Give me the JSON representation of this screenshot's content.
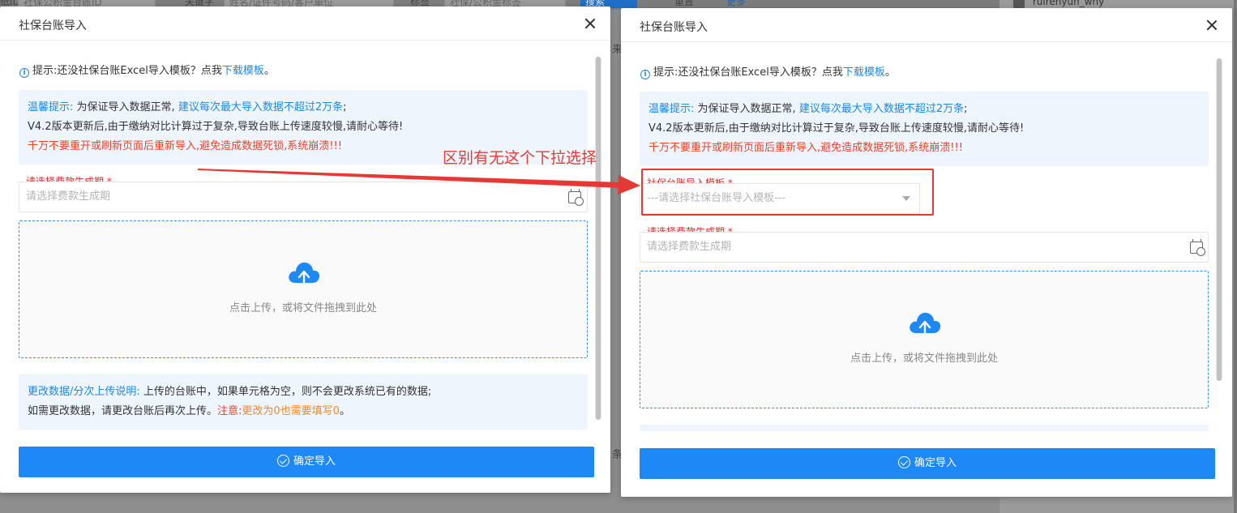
{
  "background": {
    "filter_fragments": [
      "纸ID",
      "社保公积金台账ID",
      "关键字",
      "姓名/证件号码/客户单位",
      "标签",
      "社保/公积金标签"
    ],
    "search_label": "搜索",
    "reset_label": "重置",
    "more_label": "更多",
    "username": "ruirenyun_why",
    "side_fragments": [
      "来",
      "条"
    ]
  },
  "dialogs": [
    {
      "title": "社保台账导入",
      "tip_prefix": "提示:还没社保台账Excel导入模板？点我",
      "tip_link": "下载模板",
      "tip_suffix": "。",
      "notice_title": "温馨提示:",
      "notice_line1_a": "为保证导入数据正常,",
      "notice_line1_b": "建议每次最大导入数据不超过2万条",
      "notice_line1_c": ";",
      "notice_line2": "V4.2版本更新后,由于缴纳对比计算过于复杂,导致台账上传速度较慢,请耐心等待!",
      "notice_line3": "千万不要重开或刷新页面后重新导入,避免造成数据死锁,系统崩溃!!!",
      "date_label": "请选择费款生成期",
      "date_placeholder": "请选择费款生成期",
      "upload_text": "点击上传，或将文件拖拽到此处",
      "desc_title": "更改数据/分次上传说明:",
      "desc_line1": "上传的台账中，如果单元格为空，则不会更改系统已有的数据;",
      "desc_line2_a": "如需更改数据，请更改台账后再次上传。",
      "desc_line2_b": "注意:",
      "desc_line2_c": "更改为0也需要填写0",
      "desc_line2_d": "。",
      "submit_label": "确定导入"
    },
    {
      "title": "社保台账导入",
      "tip_prefix": "提示:还没社保台账Excel导入模板？点我",
      "tip_link": "下载模板",
      "tip_suffix": "。",
      "notice_title": "温馨提示:",
      "notice_line1_a": "为保证导入数据正常,",
      "notice_line1_b": "建议每次最大导入数据不超过2万条",
      "notice_line1_c": ";",
      "notice_line2": "V4.2版本更新后,由于缴纳对比计算过于复杂,导致台账上传速度较慢,请耐心等待!",
      "notice_line3": "千万不要重开或刷新页面后重新导入,避免造成数据死锁,系统崩溃!!!",
      "template_label": "社保台账导入模板",
      "template_placeholder": "---请选择社保台账导入模板---",
      "date_label": "请选择费款生成期",
      "date_placeholder": "请选择费款生成期",
      "upload_text": "点击上传，或将文件拖拽到此处",
      "submit_label": "确定导入"
    }
  ],
  "annotation": {
    "text": "区别有无这个下拉选择"
  },
  "colors": {
    "accent_blue": "#1e88f5",
    "warning_red": "#e8442b",
    "annotation_red": "#e53935",
    "note_orange": "#f08a24",
    "notice_bg": "#eef5fc"
  },
  "icons": [
    "info-icon",
    "close-icon",
    "calendar-icon",
    "upload-cloud-icon",
    "check-circle-icon",
    "chevron-down-icon",
    "arrow-icon"
  ]
}
